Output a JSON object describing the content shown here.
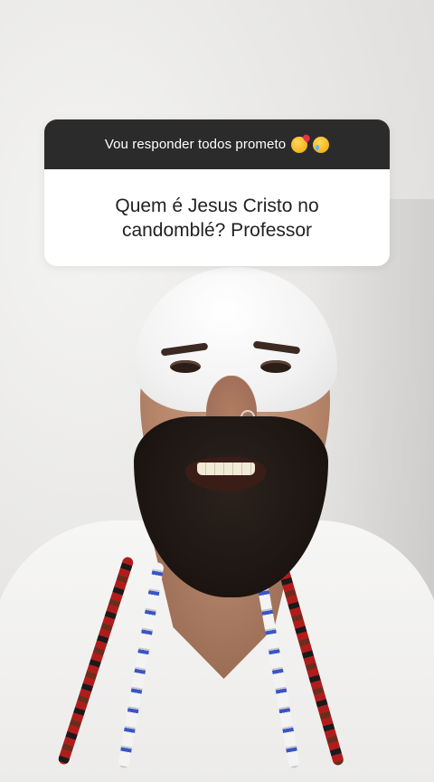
{
  "question_sticker": {
    "header_text": "Vou responder todos prometo",
    "header_emojis": [
      "face-blowing-kiss",
      "face-holding-back-tears"
    ],
    "question_text": "Quem é Jesus Cristo no candomblé? Professor",
    "header_bg": "#2b2b2b",
    "body_bg": "#ffffff"
  },
  "scene": {
    "background": "#e9e8e6"
  }
}
